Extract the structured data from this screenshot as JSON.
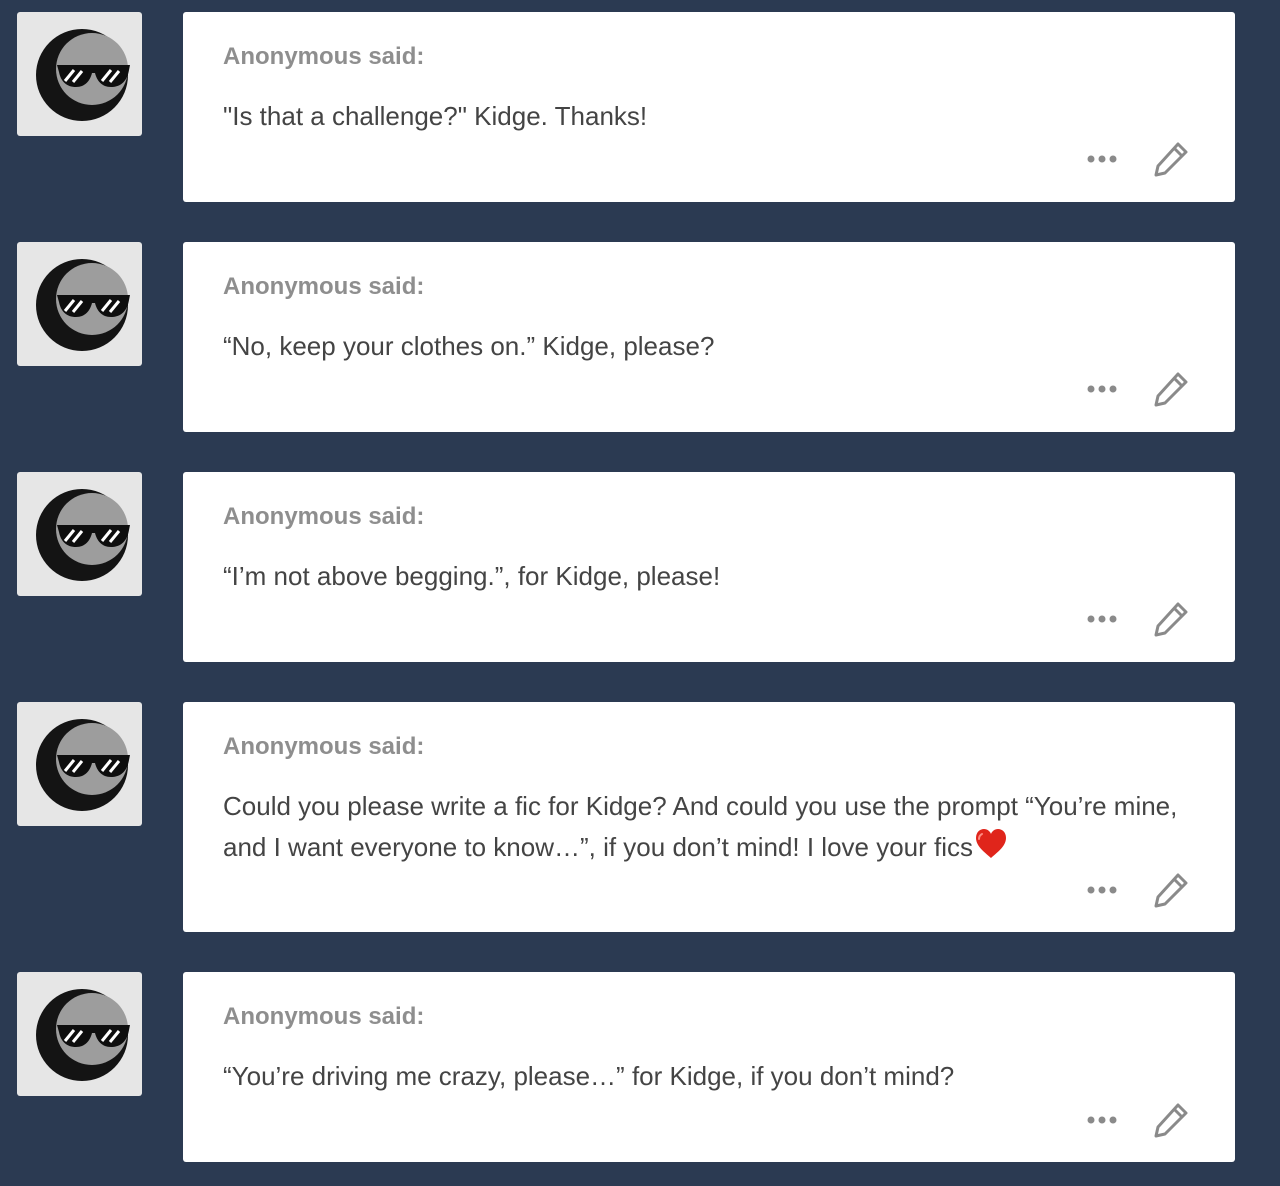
{
  "asks": [
    {
      "asker": "Anonymous said:",
      "avatar_icon": "sunglasses-moon-avatar-icon",
      "question": "\"Is that a challenge?\" Kidge. Thanks!"
    },
    {
      "asker": "Anonymous said:",
      "avatar_icon": "sunglasses-moon-avatar-icon",
      "question": "“No, keep your clothes on.” Kidge, please?"
    },
    {
      "asker": "Anonymous said:",
      "avatar_icon": "sunglasses-moon-avatar-icon",
      "question": "“I’m not above begging.”, for Kidge, please!"
    },
    {
      "asker": "Anonymous said:",
      "avatar_icon": "sunglasses-moon-avatar-icon",
      "question": "Could you please write a fic for Kidge? And could you use the prompt “You’re mine, and I want everyone to know…”, if you don’t mind! I love your fics",
      "trailing_icon": "red-heart-icon"
    },
    {
      "asker": "Anonymous said:",
      "avatar_icon": "sunglasses-moon-avatar-icon",
      "question": "“You’re driving me crazy, please…” for Kidge, if you don’t mind?"
    }
  ],
  "icons": {
    "more": "more-options-icon",
    "edit": "pencil-edit-icon"
  },
  "colors": {
    "background": "#2b3a52",
    "card": "#ffffff",
    "asker_text": "#8e8e8e",
    "question_text": "#444444",
    "icon": "#8a8a8a",
    "heart": "#e0251b"
  }
}
